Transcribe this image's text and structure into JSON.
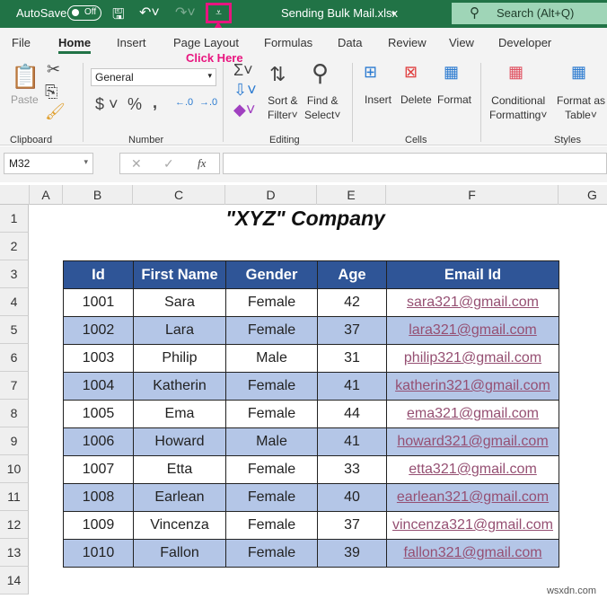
{
  "titlebar": {
    "autosave": "AutoSave",
    "toggle": "Off",
    "filename": "Sending Bulk Mail.xlsx",
    "search": "Search (Alt+Q)"
  },
  "annotation": {
    "text": "Click Here",
    "color": "#e8157f"
  },
  "menu": [
    "File",
    "Home",
    "Insert",
    "Page Layout",
    "Formulas",
    "Data",
    "Review",
    "View",
    "Developer"
  ],
  "ribbon": {
    "paste": "Paste",
    "clipboard": "Clipboard",
    "number_format": "General",
    "number": "Number",
    "sort1": "Sort &",
    "sort2": "Filter",
    "find1": "Find &",
    "find2": "Select",
    "editing": "Editing",
    "insert": "Insert",
    "delete": "Delete",
    "format": "Format",
    "cells": "Cells",
    "cond1": "Conditional",
    "cond2": "Formatting",
    "fmt1": "Format as",
    "fmt2": "Table",
    "styles": "Styles"
  },
  "formula_bar": {
    "name_box": "M32",
    "fx": "fx",
    "value": ""
  },
  "columns": [
    "A",
    "B",
    "C",
    "D",
    "E",
    "F",
    "G"
  ],
  "rows": [
    "1",
    "2",
    "3",
    "4",
    "5",
    "6",
    "7",
    "8",
    "9",
    "10",
    "11",
    "12",
    "13",
    "14"
  ],
  "sheet_title": "\"XYZ\" Company",
  "table": {
    "headers": [
      "Id",
      "First Name",
      "Gender",
      "Age",
      "Email Id"
    ],
    "rows": [
      [
        "1001",
        "Sara",
        "Female",
        "42",
        "sara321@gmail.com"
      ],
      [
        "1002",
        "Lara",
        "Female",
        "37",
        "lara321@gmail.com"
      ],
      [
        "1003",
        "Philip",
        "Male",
        "31",
        "philip321@gmail.com"
      ],
      [
        "1004",
        "Katherin",
        "Female",
        "41",
        "katherin321@gmail.com"
      ],
      [
        "1005",
        "Ema",
        "Female",
        "44",
        "ema321@gmail.com"
      ],
      [
        "1006",
        "Howard",
        "Male",
        "41",
        "howard321@gmail.com"
      ],
      [
        "1007",
        "Etta",
        "Female",
        "33",
        "etta321@gmail.com"
      ],
      [
        "1008",
        "Earlean",
        "Female",
        "40",
        "earlean321@gmail.com"
      ],
      [
        "1009",
        "Vincenza",
        "Female",
        "37",
        "vincenza321@gmail.com"
      ],
      [
        "1010",
        "Fallon",
        "Female",
        "39",
        "fallon321@gmail.com"
      ]
    ]
  },
  "colors": {
    "titlebar": "#217346",
    "header_fill": "#2f5597",
    "band_fill": "#b4c6e7",
    "link": "#954f72"
  },
  "watermark": "wsxdn.com"
}
